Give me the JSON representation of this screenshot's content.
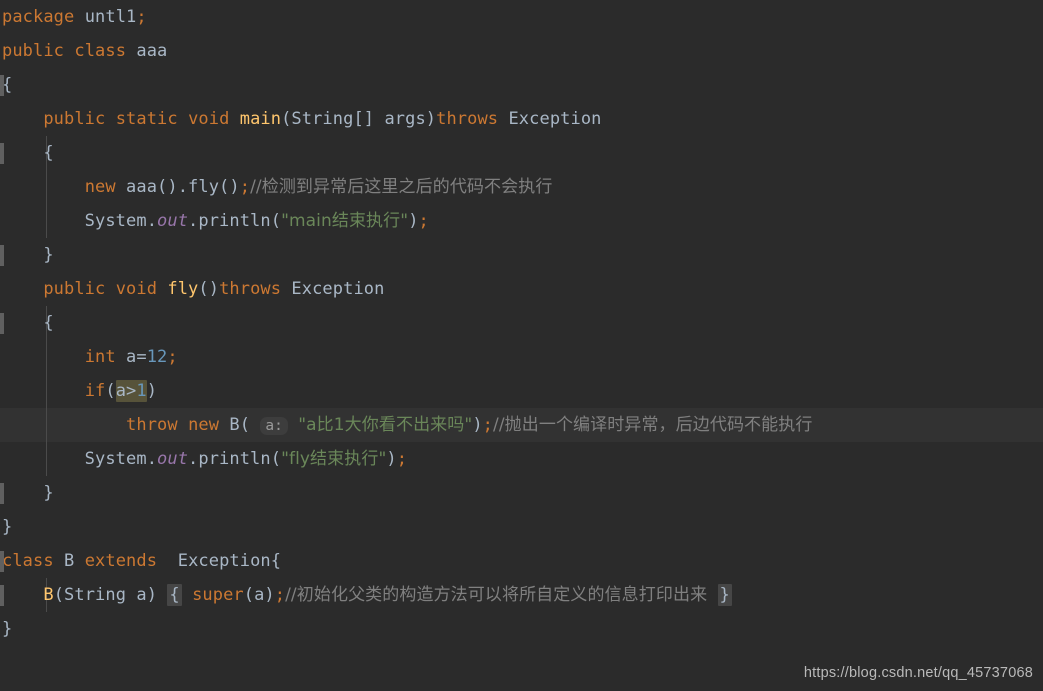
{
  "editor": {
    "theme_name": "Darcula",
    "language": "Java",
    "colors": {
      "background": "#2b2b2b",
      "caret_line_background": "#323232",
      "default_text": "#a9b7c6",
      "keyword": "#cc7832",
      "string": "#6a8759",
      "number": "#6897bb",
      "comment": "#808080",
      "method_declaration": "#ffc66d",
      "static_field": "#9876aa",
      "selection": "#57533a",
      "brace_match": "#464646",
      "inlay_hint_background": "#3d3d3d",
      "fold_marker": "#606060",
      "indent_guide": "#4b4b4b"
    },
    "lines": [
      {
        "tokens": [
          {
            "t": "package",
            "c": "keyword"
          },
          {
            "t": " ",
            "c": "plain"
          },
          {
            "t": "untl1",
            "c": "plain"
          },
          {
            "t": ";",
            "c": "keyword"
          }
        ]
      },
      {
        "tokens": [
          {
            "t": "public",
            "c": "keyword"
          },
          {
            "t": " ",
            "c": "plain"
          },
          {
            "t": "class",
            "c": "keyword"
          },
          {
            "t": " aaa",
            "c": "plain"
          }
        ]
      },
      {
        "fold": true,
        "tokens": [
          {
            "t": "{",
            "c": "plain"
          }
        ]
      },
      {
        "tokens": [
          {
            "t": "    ",
            "c": "plain"
          },
          {
            "t": "public",
            "c": "keyword"
          },
          {
            "t": " ",
            "c": "plain"
          },
          {
            "t": "static",
            "c": "keyword"
          },
          {
            "t": " ",
            "c": "plain"
          },
          {
            "t": "void",
            "c": "keyword"
          },
          {
            "t": " ",
            "c": "plain"
          },
          {
            "t": "main",
            "c": "method"
          },
          {
            "t": "(String[] args)",
            "c": "plain"
          },
          {
            "t": "throws",
            "c": "keyword"
          },
          {
            "t": " Exception",
            "c": "plain"
          }
        ]
      },
      {
        "fold": true,
        "tokens": [
          {
            "t": "    {",
            "c": "plain"
          }
        ]
      },
      {
        "tokens": [
          {
            "t": "        ",
            "c": "plain"
          },
          {
            "t": "new",
            "c": "keyword"
          },
          {
            "t": " aaa().fly()",
            "c": "plain"
          },
          {
            "t": ";",
            "c": "keyword"
          },
          {
            "t": "//检测到异常后这里之后的代码不会执行",
            "c": "comment"
          }
        ]
      },
      {
        "tokens": [
          {
            "t": "        System.",
            "c": "plain"
          },
          {
            "t": "out",
            "c": "field"
          },
          {
            "t": ".println(",
            "c": "plain"
          },
          {
            "t": "\"main结束执行\"",
            "c": "string"
          },
          {
            "t": ")",
            "c": "plain"
          },
          {
            "t": ";",
            "c": "keyword"
          }
        ]
      },
      {
        "fold": true,
        "tokens": [
          {
            "t": "    }",
            "c": "plain"
          }
        ]
      },
      {
        "tokens": [
          {
            "t": "    ",
            "c": "plain"
          },
          {
            "t": "public",
            "c": "keyword"
          },
          {
            "t": " ",
            "c": "plain"
          },
          {
            "t": "void",
            "c": "keyword"
          },
          {
            "t": " ",
            "c": "plain"
          },
          {
            "t": "fly",
            "c": "method"
          },
          {
            "t": "()",
            "c": "plain"
          },
          {
            "t": "throws",
            "c": "keyword"
          },
          {
            "t": " Exception",
            "c": "plain"
          }
        ]
      },
      {
        "fold": true,
        "tokens": [
          {
            "t": "    {",
            "c": "plain"
          }
        ]
      },
      {
        "tokens": [
          {
            "t": "        ",
            "c": "plain"
          },
          {
            "t": "int",
            "c": "keyword"
          },
          {
            "t": " a=",
            "c": "plain"
          },
          {
            "t": "12",
            "c": "number"
          },
          {
            "t": ";",
            "c": "keyword"
          }
        ]
      },
      {
        "tokens": [
          {
            "t": "        ",
            "c": "plain"
          },
          {
            "t": "if",
            "c": "keyword"
          },
          {
            "t": "(",
            "c": "plain"
          },
          {
            "t": "a>",
            "c": "selected-plain"
          },
          {
            "t": "1",
            "c": "selected-number"
          },
          {
            "t": ")",
            "c": "plain"
          }
        ]
      },
      {
        "caret": true,
        "tokens": [
          {
            "t": "            ",
            "c": "plain"
          },
          {
            "t": "throw",
            "c": "keyword"
          },
          {
            "t": " ",
            "c": "plain"
          },
          {
            "t": "new",
            "c": "keyword"
          },
          {
            "t": " B( ",
            "c": "plain"
          },
          {
            "t": "a:",
            "c": "inlay"
          },
          {
            "t": " ",
            "c": "plain"
          },
          {
            "t": "\"a比1大你看不出来吗\"",
            "c": "string"
          },
          {
            "t": ")",
            "c": "plain"
          },
          {
            "t": ";",
            "c": "keyword"
          },
          {
            "t": "//抛出一个编译时异常，后边代码不能执行",
            "c": "comment"
          }
        ]
      },
      {
        "tokens": [
          {
            "t": "        System.",
            "c": "plain"
          },
          {
            "t": "out",
            "c": "field"
          },
          {
            "t": ".println(",
            "c": "plain"
          },
          {
            "t": "\"fly结束执行\"",
            "c": "string"
          },
          {
            "t": ")",
            "c": "plain"
          },
          {
            "t": ";",
            "c": "keyword"
          }
        ]
      },
      {
        "fold": true,
        "tokens": [
          {
            "t": "    }",
            "c": "plain"
          }
        ]
      },
      {
        "tokens": [
          {
            "t": "}",
            "c": "plain"
          }
        ]
      },
      {
        "fold": true,
        "tokens": [
          {
            "t": "class",
            "c": "keyword"
          },
          {
            "t": " B ",
            "c": "plain"
          },
          {
            "t": "extends",
            "c": "keyword"
          },
          {
            "t": "  Exception{",
            "c": "plain"
          }
        ]
      },
      {
        "fold": true,
        "tokens": [
          {
            "t": "    ",
            "c": "plain"
          },
          {
            "t": "B",
            "c": "method"
          },
          {
            "t": "(String a) ",
            "c": "plain"
          },
          {
            "t": "{",
            "c": "brace-match"
          },
          {
            "t": " ",
            "c": "plain"
          },
          {
            "t": "super",
            "c": "keyword"
          },
          {
            "t": "(a)",
            "c": "plain"
          },
          {
            "t": ";",
            "c": "keyword"
          },
          {
            "t": "//初始化父类的构造方法可以将所自定义的信息打印出来",
            "c": "comment"
          },
          {
            "t": " ",
            "c": "plain"
          },
          {
            "t": "}",
            "c": "brace-match"
          }
        ]
      },
      {
        "tokens": [
          {
            "t": "}",
            "c": "plain"
          }
        ]
      }
    ]
  },
  "watermark": {
    "text": "https://blog.csdn.net/qq_45737068"
  }
}
